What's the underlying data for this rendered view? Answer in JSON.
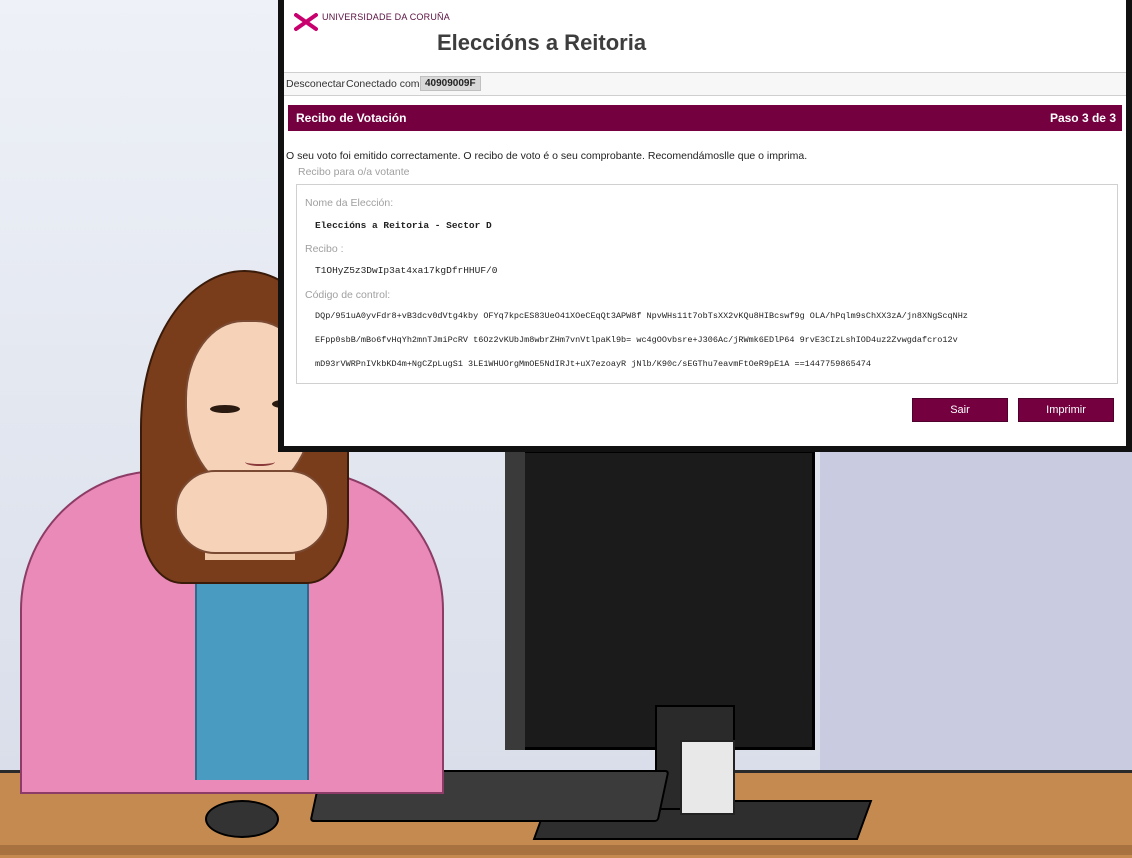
{
  "header": {
    "university_name": "UNIVERSIDADE DA CORUÑA",
    "title": "Eleccións a Reitoria"
  },
  "statusbar": {
    "disconnect": "Desconectar",
    "connected_as": "Conectado como",
    "user": "40909009F"
  },
  "panel": {
    "title": "Recibo de Votación",
    "step": "Paso 3 de 3"
  },
  "message": "O seu voto foi emitido correctamente. O recibo de voto é o seu comprobante. Recomendámoslle que o imprima.",
  "receipt_subtitle": "Recibo para o/a votante",
  "receipt": {
    "election_label": "Nome da Elección:",
    "election_value": "Eleccións a Reitoria - Sector D",
    "receipt_label": "Recibo :",
    "receipt_value": "T1OHyZ5z3DwIp3at4xa17kgDfrHHUF/0",
    "control_label": "Código de control:",
    "control_lines": [
      "DQp/951uA0yvFdr8+vB3dcv0dVtg4kby OFYq7kpcES83UeO41XOeCEqQt3APW8f NpvWHs11t7obTsXX2vKQu8HIBcswf9g OLA/hPqlm9sChXX3zA/jn8XNgScqNHz",
      "EFpp0sbB/mBo6fvHqYh2mnTJmiPcRV t6Oz2vKUbJm8wbrZHm7vnVtlpaKl9b= wc4gOOvbsre+J306Ac/jRWmk6EDlP64 9rvE3CIzLshIOD4uz2Zvwgdafcro12v",
      "mD93rVWRPnIVkbKD4m+NgCZpLugS1 3LE1WHUOrgMmOE5NdIRJt+uX7ezoayR jNlb/K90c/sEGThu7eavmFtOeR9pE1A ==1447759865474"
    ]
  },
  "buttons": {
    "exit": "Sair",
    "print": "Imprimir"
  },
  "colors": {
    "accent": "#74003f"
  }
}
